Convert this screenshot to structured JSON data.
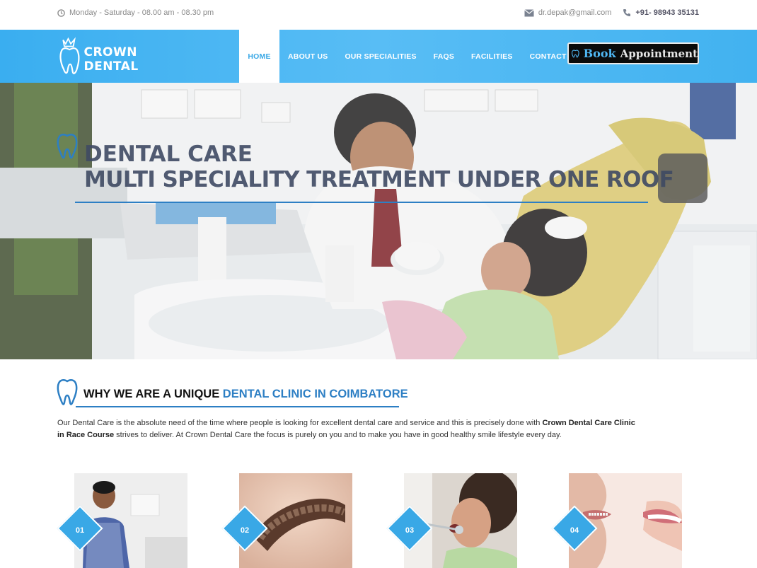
{
  "topbar": {
    "hours": "Monday - Saturday - 08.00 am - 08.30 pm",
    "email": "dr.depak@gmail.com",
    "phone": "+91- 98943 35131"
  },
  "brand": {
    "name": "CROWN DENTAL",
    "accent_color": "#39a8e6",
    "nav_gradient": [
      "#3aaef0",
      "#58bdf5"
    ]
  },
  "nav": {
    "items": [
      {
        "label": "HOME",
        "active": true
      },
      {
        "label": "ABOUT US",
        "active": false
      },
      {
        "label": "OUR SPECIALITIES",
        "active": false
      },
      {
        "label": "FAQS",
        "active": false
      },
      {
        "label": "FACILITIES",
        "active": false
      },
      {
        "label": "CONTACT US",
        "active": false
      }
    ],
    "book_word1": "Book",
    "book_word2": "Appointment"
  },
  "hero": {
    "line1": "DENTAL CARE",
    "line2": "MULTI SPECIALITY TREATMENT UNDER ONE ROOF"
  },
  "why": {
    "heading_plain": "WHY WE ARE A UNIQUE ",
    "heading_accent": "DENTAL CLINIC IN COIMBATORE",
    "para_part1": "Our Dental Care is the absolute need of the time where people is looking for excellent dental care and service and this is precisely done with ",
    "para_bold": "Crown Dental Care Clinic in Race Course",
    "para_part2": " strives to deliver. At Crown Dental Care the focus is purely on you and to make you have in good healthy smile lifestyle every day."
  },
  "cards": [
    {
      "num": "01",
      "image": "doctor-portrait"
    },
    {
      "num": "02",
      "image": "denture"
    },
    {
      "num": "03",
      "image": "child-dental-exam"
    },
    {
      "num": "04",
      "image": "braces-smile"
    }
  ]
}
